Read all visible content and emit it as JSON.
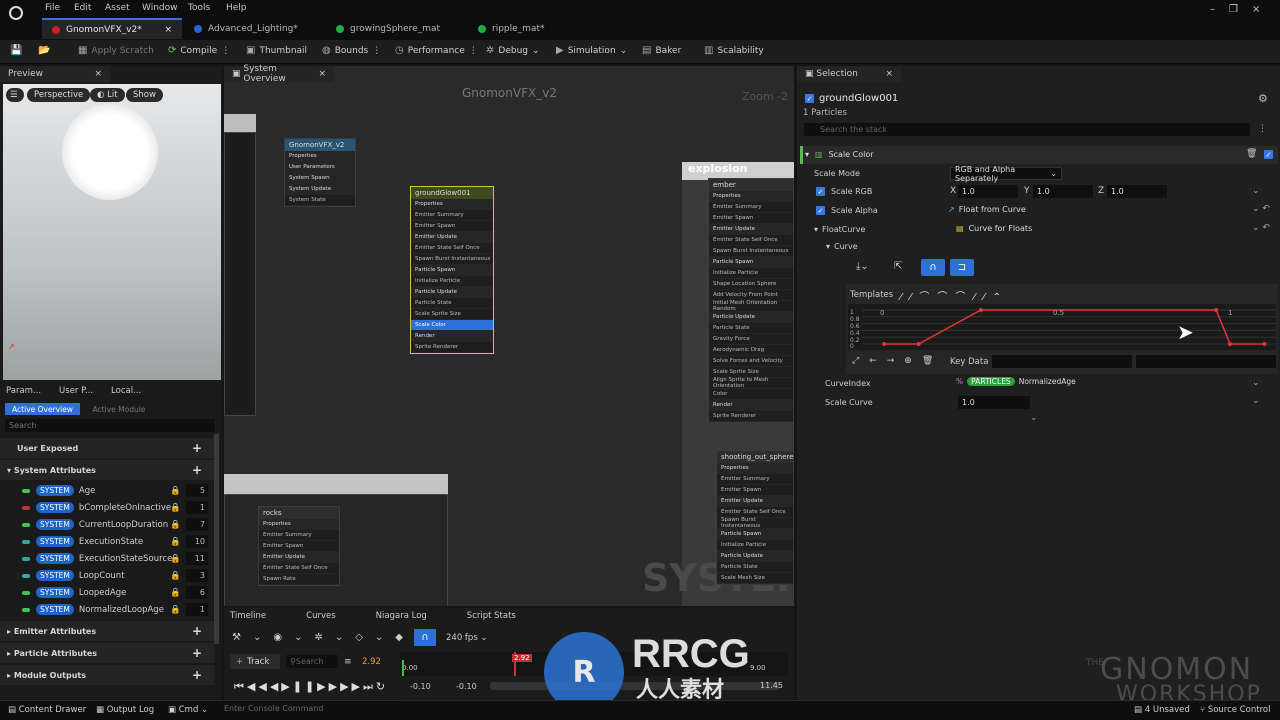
{
  "menu": [
    "File",
    "Edit",
    "Asset",
    "Window",
    "Tools",
    "Help"
  ],
  "tabs": [
    {
      "label": "GnomonVFX_v2*",
      "color": "#cc2222"
    },
    {
      "label": "Advanced_Lighting*",
      "color": "#2266cc"
    },
    {
      "label": "growingSphere_mat",
      "color": "#22aa44"
    },
    {
      "label": "ripple_mat*",
      "color": "#22aa44"
    }
  ],
  "toolbar": {
    "apply_scratch": "Apply Scratch",
    "compile": "Compile",
    "thumbnail": "Thumbnail",
    "bounds": "Bounds",
    "performance": "Performance",
    "debug": "Debug",
    "simulation": "Simulation",
    "baker": "Baker",
    "scalability": "Scalability"
  },
  "preview": {
    "title": "Preview",
    "perspective": "Perspective",
    "lit": "Lit",
    "show": "Show"
  },
  "params": {
    "tabs": [
      "Param...",
      "User P...",
      "Local..."
    ],
    "active_overview": "Active Overview",
    "active_module": "Active Module",
    "search_placeholder": "Search",
    "user_exposed": "User Exposed",
    "system_attributes": "System Attributes",
    "badge": "SYSTEM",
    "attrs": [
      {
        "name": "Age",
        "value": "5",
        "color": "#3fc25a"
      },
      {
        "name": "bCompleteOnInactive",
        "value": "1",
        "color": "#c22f2f"
      },
      {
        "name": "CurrentLoopDuration",
        "value": "7",
        "color": "#3fc25a"
      },
      {
        "name": "ExecutionState",
        "value": "10",
        "color": "#2fa89e"
      },
      {
        "name": "ExecutionStateSource",
        "value": "11",
        "color": "#2fa89e"
      },
      {
        "name": "LoopCount",
        "value": "3",
        "color": "#2fa89e"
      },
      {
        "name": "LoopedAge",
        "value": "6",
        "color": "#3fc25a"
      },
      {
        "name": "NormalizedLoopAge",
        "value": "1",
        "color": "#3fc25a"
      }
    ],
    "emitter_attributes": "Emitter Attributes",
    "particle_attributes": "Particle Attributes",
    "module_outputs": "Module Outputs"
  },
  "graph": {
    "tab": "System Overview",
    "title": "GnomonVFX_v2",
    "zoom": "Zoom -2",
    "watermark": "SYSTEM",
    "explosion": "explosion",
    "system_node": {
      "title": "GnomonVFX_v2",
      "rows": [
        "Properties",
        "User Parameters",
        "System Spawn",
        "System Update",
        "System State"
      ]
    },
    "glow_node": {
      "title": "groundGlow001",
      "rows": [
        "Properties",
        "Emitter Summary",
        "Emitter Spawn",
        "Emitter Update",
        "Emitter State Self Once",
        "Spawn Burst Instantaneous",
        "Particle Spawn",
        "Initialize Particle",
        "Particle Update",
        "Particle State",
        "Scale Sprite Size",
        "Scale Color",
        "Render",
        "Sprite Renderer"
      ],
      "stage": "Stage"
    },
    "ember_node": {
      "title": "ember",
      "rows": [
        "Properties",
        "Emitter Summary",
        "Emitter Spawn",
        "Emitter Update",
        "Emitter State Self Once",
        "Spawn Burst Instantaneous",
        "Particle Spawn",
        "Initialize Particle",
        "Shape Location Sphere",
        "Add Velocity From Point",
        "Initial Mesh Orientation Random",
        "Particle Update",
        "Particle State",
        "Gravity Force",
        "Aerodynamic Drag",
        "Solve Forces and Velocity",
        "Scale Sprite Size",
        "Align Sprite to Mesh Orientation",
        "Color",
        "Render",
        "Sprite Renderer"
      ]
    },
    "shooting_node": {
      "title": "shooting_out_sphere",
      "rows": [
        "Properties",
        "Emitter Summary",
        "Emitter Spawn",
        "Emitter Update",
        "Emitter State Self Once",
        "Spawn Burst Instantaneous",
        "Particle Spawn",
        "Initialize Particle",
        "Particle Update",
        "Particle State",
        "Scale Mesh Size"
      ]
    },
    "rocks_node": {
      "title": "rocks",
      "rows": [
        "Properties",
        "Emitter Summary",
        "Emitter Spawn",
        "Emitter Update",
        "Emitter State Self Once",
        "Spawn Rate"
      ],
      "stage": "Stage"
    }
  },
  "selection": {
    "tab": "Selection",
    "name": "groundGlow001",
    "sub": "1 Particles",
    "search_placeholder": "Search the stack",
    "module": "Scale Color",
    "scale_mode_label": "Scale Mode",
    "scale_mode": "RGB and Alpha Separately",
    "scale_rgb": "Scale RGB",
    "x": "1.0",
    "y": "1.0",
    "z": "1.0",
    "scale_alpha": "Scale Alpha",
    "float_from_curve": "Float from Curve",
    "float_curve": "FloatCurve",
    "curve_for_floats": "Curve for Floats",
    "curve": "Curve",
    "templates": "Templates",
    "key_data": "Key Data",
    "curve_index": "CurveIndex",
    "particles_badge": "PARTICLES",
    "normalized_age": "NormalizedAge",
    "scale_curve": "Scale Curve",
    "scale_curve_val": "1.0",
    "curve_labels_x": [
      "0",
      "0.5",
      "1"
    ],
    "curve_labels_y": [
      "1",
      "0.8",
      "0.6",
      "0.4",
      "0.2",
      "0"
    ]
  },
  "timeline": {
    "tabs": [
      "Timeline",
      "Curves",
      "Niagara Log",
      "Script Stats"
    ],
    "fps": "240 fps",
    "track": "Track",
    "search": "Search",
    "time": "2.92",
    "playhead": "2.92",
    "t0": "0.00",
    "t9": "9.00",
    "start": "-0.10",
    "start2": "-0.10",
    "end": "11.45"
  },
  "status": {
    "content_drawer": "Content Drawer",
    "output_log": "Output Log",
    "cmd": "Cmd",
    "console_placeholder": "Enter Console Command",
    "unsaved": "4 Unsaved",
    "source_control": "Source Control"
  },
  "watermark": {
    "rrcg": "RRCG",
    "chinese": "人人素材",
    "gnomon": "GNOMON",
    "workshop": "WORKSHOP",
    "the": "THE"
  },
  "chart_data": {
    "type": "line",
    "x": [
      0,
      0.1,
      0.28,
      0.96,
      1.0,
      1.1
    ],
    "y": [
      0,
      0,
      1,
      1,
      0,
      0
    ]
  }
}
